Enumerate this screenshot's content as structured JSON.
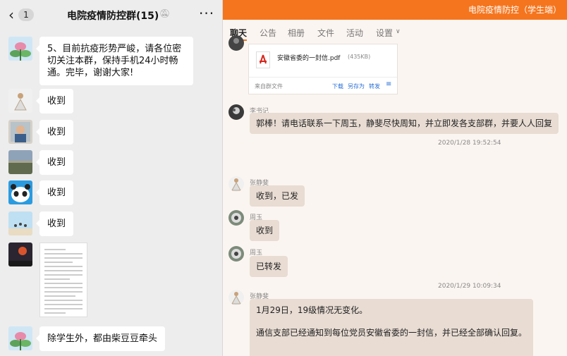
{
  "left": {
    "header": {
      "back_icon": "chevron-left-icon",
      "unread": "1",
      "title": "电院疫情防控群(15)",
      "mute_icon": "bell-off-icon",
      "more": "···"
    },
    "messages": [
      {
        "text_lines": [
          "5、目前抗疫形势严峻，请各位密",
          "切关注本群，保持手机24小时畅",
          "通。完毕，谢谢大家!"
        ]
      },
      {
        "text": "收到"
      },
      {
        "text": "收到"
      },
      {
        "text": "收到"
      },
      {
        "text": "收到"
      },
      {
        "text": "收到"
      },
      {
        "text": "除学生外，都由柴豆豆牵头"
      }
    ]
  },
  "right": {
    "window_title": "电院疫情防控（学生端）",
    "accent": "#f5751e",
    "tabs": [
      "聊天",
      "公告",
      "相册",
      "文件",
      "活动",
      "设置"
    ],
    "settings_chevron": "chevron-down-icon",
    "file": {
      "name": "安徽省委的一封信.pdf",
      "size": "(435KB)",
      "source": "来自群文件",
      "actions": [
        "下载",
        "另存为",
        "转发"
      ],
      "menu_icon": "menu-icon"
    },
    "messages": [
      {
        "sender": "李书记",
        "text": "郭棒！请电话联系一下周玉，静斐尽快周知，并立即发各支部群，并要人人回复"
      },
      {
        "time": "2020/1/28 19:52:54"
      },
      {
        "sender": "张静斐",
        "text": "收到，已发"
      },
      {
        "sender": "周玉",
        "text": "收到"
      },
      {
        "sender": "周玉",
        "text": "已转发"
      },
      {
        "time": "2020/1/29 10:09:34"
      },
      {
        "sender": "张静斐",
        "text_lines": [
          "1月29日，19级情况无变化。",
          "",
          "通信支部已经通知到每位党员安徽省委的一封信，并已经全部确认回复。"
        ]
      }
    ]
  }
}
